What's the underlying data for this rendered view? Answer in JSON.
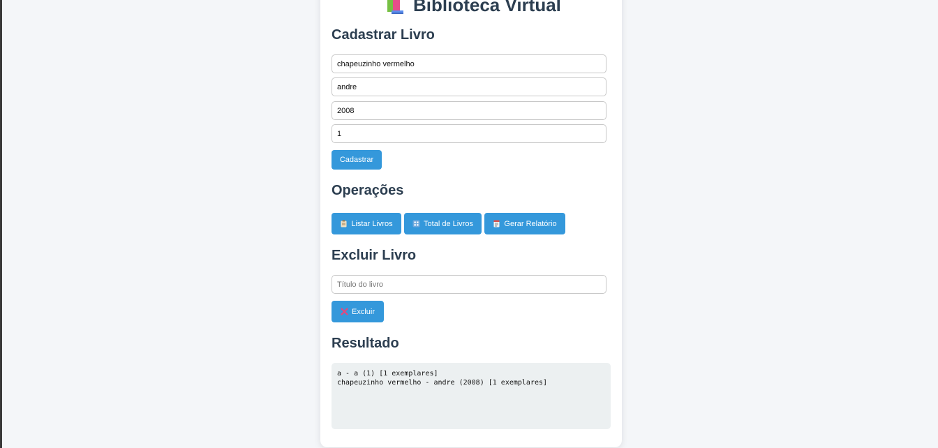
{
  "app": {
    "title": "Biblioteca Virtual",
    "title_icon": "books-icon"
  },
  "cadastro": {
    "heading": "Cadastrar Livro",
    "fields": {
      "titulo": "chapeuzinho vermelho",
      "autor": "andre",
      "ano": "2008",
      "exemplares": "1"
    },
    "submit_label": "Cadastrar"
  },
  "operacoes": {
    "heading": "Operações",
    "buttons": [
      {
        "label": "Listar Livros",
        "icon": "clipboard-icon"
      },
      {
        "label": "Total de Livros",
        "icon": "numbers-icon"
      },
      {
        "label": "Gerar Relatório",
        "icon": "report-icon"
      }
    ]
  },
  "excluir": {
    "heading": "Excluir Livro",
    "title_placeholder": "Título do livro",
    "title_value": "",
    "button_label": "Excluir",
    "button_icon": "cross-icon"
  },
  "resultado": {
    "heading": "Resultado",
    "lines": [
      "a - a (1) [1 exemplares]",
      "chapeuzinho vermelho - andre (2008) [1 exemplares]"
    ]
  },
  "colors": {
    "accent": "#3498db",
    "heading": "#2c3e50",
    "result_bg": "#ecf0f1",
    "page_bg": "#f4f6f9"
  }
}
